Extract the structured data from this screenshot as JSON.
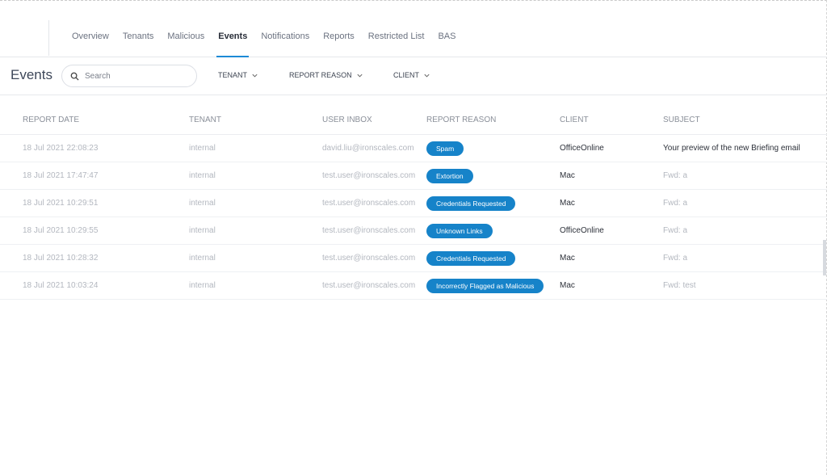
{
  "nav": {
    "tabs": [
      {
        "label": "Overview"
      },
      {
        "label": "Tenants"
      },
      {
        "label": "Malicious"
      },
      {
        "label": "Events",
        "active": true
      },
      {
        "label": "Notifications"
      },
      {
        "label": "Reports"
      },
      {
        "label": "Restricted List"
      },
      {
        "label": "BAS"
      }
    ]
  },
  "toolbar": {
    "title": "Events",
    "search_placeholder": "Search",
    "filters": [
      {
        "label": "TENANT"
      },
      {
        "label": "REPORT REASON"
      },
      {
        "label": "CLIENT"
      }
    ]
  },
  "table": {
    "columns": [
      "REPORT DATE",
      "TENANT",
      "USER INBOX",
      "REPORT REASON",
      "CLIENT",
      "SUBJECT"
    ],
    "rows": [
      {
        "date": "18 Jul 2021 22:08:23",
        "tenant": "internal",
        "inbox": "david.liu@ironscales.com",
        "reason": "Spam",
        "client": "OfficeOnline",
        "subject": "Your preview of the new Briefing email"
      },
      {
        "date": "18 Jul 2021 17:47:47",
        "tenant": "internal",
        "inbox": "test.user@ironscales.com",
        "reason": "Extortion",
        "client": "Mac",
        "subject": "Fwd: a"
      },
      {
        "date": "18 Jul 2021 10:29:51",
        "tenant": "internal",
        "inbox": "test.user@ironscales.com",
        "reason": "Credentials Requested",
        "client": "Mac",
        "subject": "Fwd: a"
      },
      {
        "date": "18 Jul 2021 10:29:55",
        "tenant": "internal",
        "inbox": "test.user@ironscales.com",
        "reason": "Unknown Links",
        "client": "OfficeOnline",
        "subject": "Fwd: a"
      },
      {
        "date": "18 Jul 2021 10:28:32",
        "tenant": "internal",
        "inbox": "test.user@ironscales.com",
        "reason": "Credentials Requested",
        "client": "Mac",
        "subject": "Fwd: a"
      },
      {
        "date": "18 Jul 2021 10:03:24",
        "tenant": "internal",
        "inbox": "test.user@ironscales.com",
        "reason": "Incorrectly Flagged as Malicious",
        "client": "Mac",
        "subject": "Fwd: test"
      }
    ]
  },
  "colors": {
    "accent": "#1c8ad6",
    "badge": "#1683c9"
  }
}
